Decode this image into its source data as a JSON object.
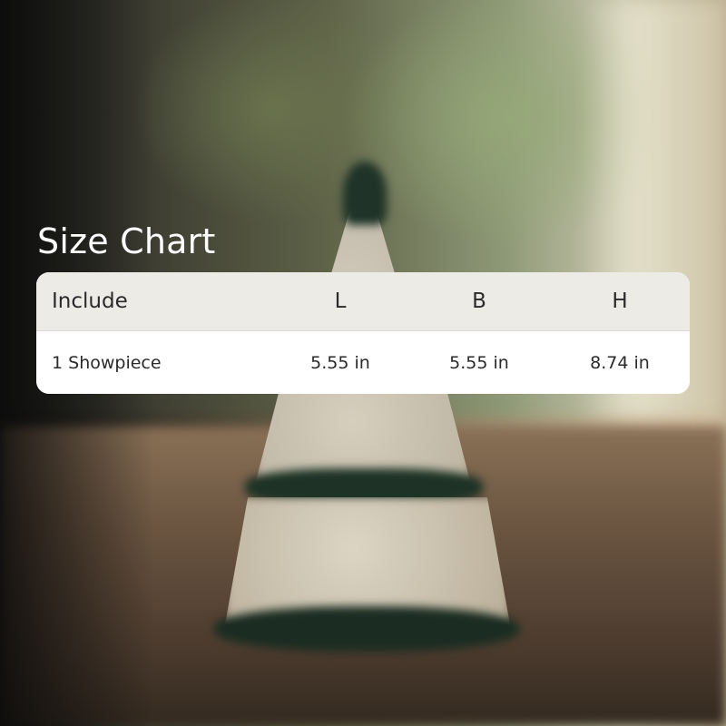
{
  "title": "Size Chart",
  "table": {
    "headers": {
      "include": "Include",
      "length": "L",
      "breadth": "B",
      "height": "H"
    },
    "rows": [
      {
        "include": "1 Showpiece",
        "length": "5.55 in",
        "breadth": "5.55 in",
        "height": "8.74 in"
      }
    ]
  },
  "colors": {
    "header_bg": "#edebe6",
    "body_bg": "#ffffff",
    "title_text": "#ffffff",
    "cell_text": "#2a2a2a"
  }
}
